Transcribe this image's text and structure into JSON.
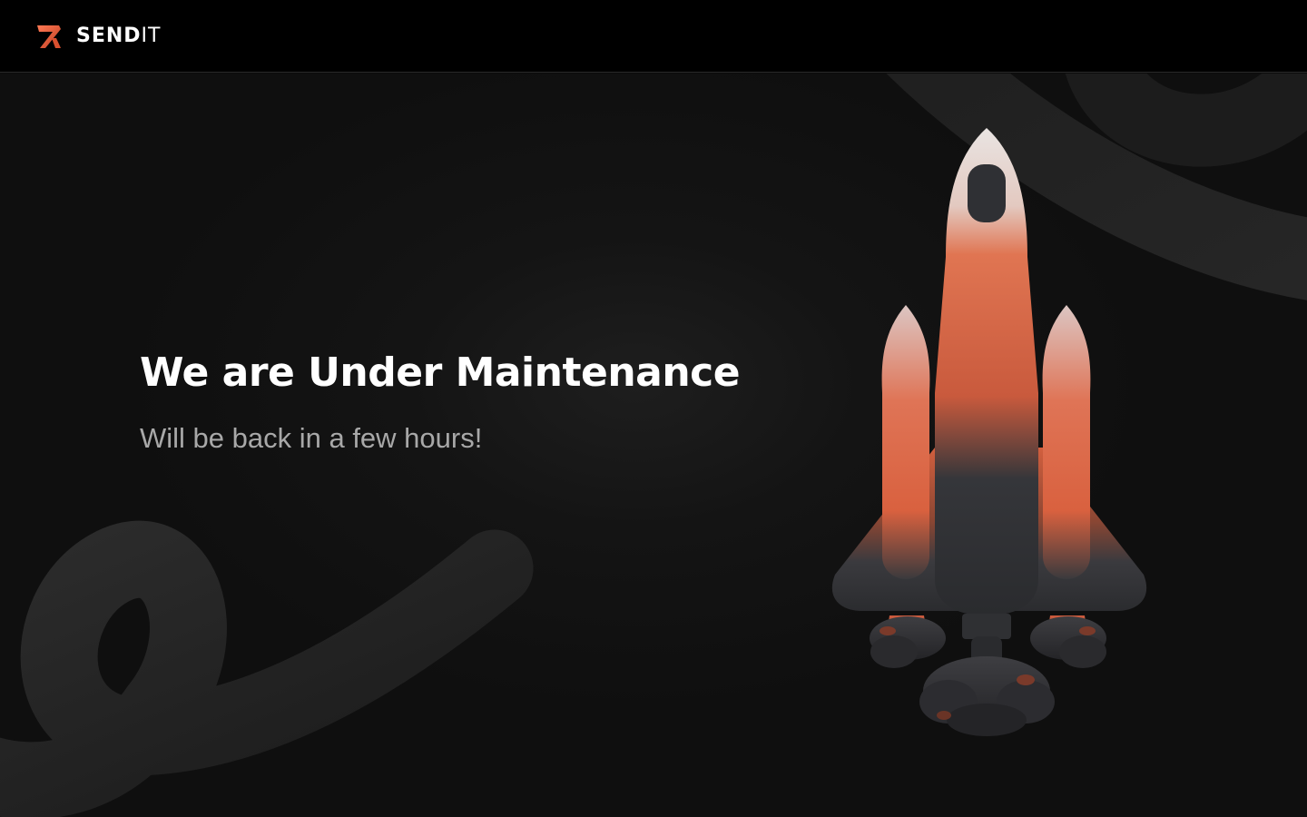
{
  "header": {
    "brand_bold": "SEND",
    "brand_light": "IT",
    "logo_icon": "sendit-logo-icon",
    "brand_color": "#e0573a"
  },
  "hero": {
    "title": "We are Under Maintenance",
    "subtitle": "Will be back in a few hours!",
    "illustration_icon": "rocket-icon"
  }
}
